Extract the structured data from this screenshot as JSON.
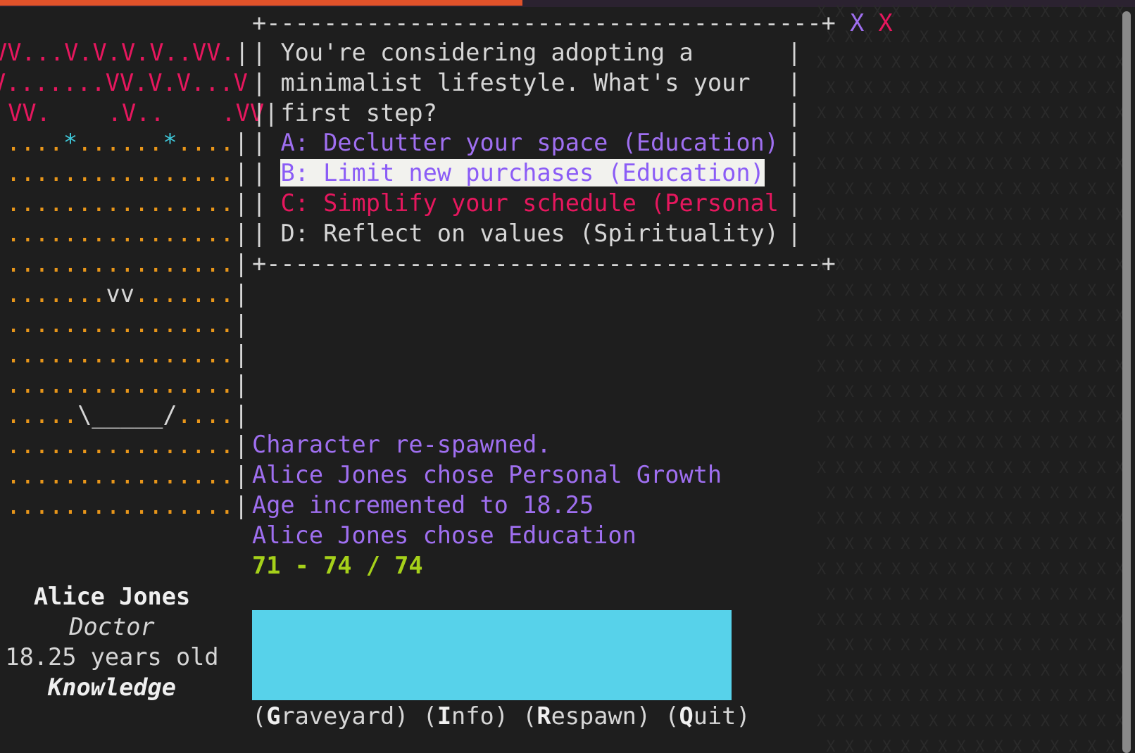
{
  "progress": 0.46,
  "dialog": {
    "border_top": "+---------------------------------------+",
    "border_bottom": "+---------------------------------------+",
    "close_marks": [
      "X",
      "X"
    ],
    "prompt_lines": [
      "You're considering adopting a",
      "minimalist lifestyle. What's your",
      "first step?"
    ],
    "choices": [
      {
        "key": "A",
        "text": "A: Declutter your space (Education)",
        "selected": false
      },
      {
        "key": "B",
        "text": "B: Limit new purchases (Education)",
        "selected": true
      },
      {
        "key": "C",
        "text": "C: Simplify your schedule (Personal",
        "selected": false
      },
      {
        "key": "D",
        "text": "D: Reflect on values (Spirituality)",
        "selected": false
      }
    ]
  },
  "map": {
    "rows": [
      "VV...V.V.V.V..VV.",
      "V.......VV.V.V...V",
      " VV.    .V..    .VV",
      ".....*......*....",
      "................",
      "................",
      "................",
      "................",
      ".......vv.......",
      "................",
      "................",
      "................",
      ".....\\_____/....",
      "................",
      "................",
      "................"
    ]
  },
  "log": [
    "Character re-spawned.",
    "Alice Jones chose Personal Growth",
    "Age incremented to 18.25",
    "Alice Jones chose Education"
  ],
  "stats_line": "71 - 74 / 74",
  "character": {
    "name": "Alice Jones",
    "occupation": "Doctor",
    "age": "18.25 years old",
    "trait": "Knowledge"
  },
  "menu": [
    {
      "hotkey": "G",
      "rest": "raveyard"
    },
    {
      "hotkey": "I",
      "rest": "nfo"
    },
    {
      "hotkey": "R",
      "rest": "espawn"
    },
    {
      "hotkey": "Q",
      "rest": "uit"
    }
  ],
  "colors": {
    "background": "#1e1e1e",
    "progress": "#e0522a",
    "accent_purple": "#9f6ff0",
    "accent_magenta": "#e6175e",
    "accent_cyan": "#57d2ea",
    "stats_green": "#a6d11a",
    "map_orange": "#e8961a"
  }
}
